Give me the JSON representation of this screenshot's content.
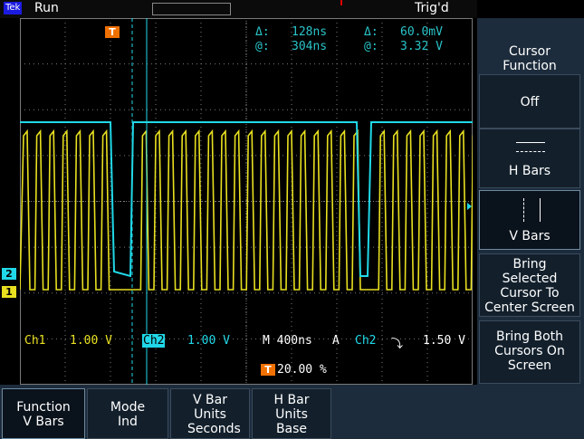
{
  "status": {
    "brand": "Tek",
    "run": "Run",
    "trigger": "Trig'd"
  },
  "cursor_readout": {
    "delta_time_label": "Δ:",
    "delta_time": "128ns",
    "delta_volt_label": "Δ:",
    "delta_volt": "60.0mV",
    "at_time_label": "@:",
    "at_time": "304ns",
    "at_volt_label": "@:",
    "at_volt": "3.32 V"
  },
  "channel_info": {
    "ch1_label": "Ch1",
    "ch1_scale": "1.00 V",
    "ch2_label": "Ch2",
    "ch2_scale": "1.00 V",
    "timebase": "M 400ns",
    "trig_mode": "A",
    "trig_source": "Ch2",
    "trig_level": "1.50 V",
    "trig_position": "20.00 %"
  },
  "markers": {
    "ch1": "1",
    "ch2": "2",
    "trigger": "T"
  },
  "side_menu": {
    "title": "Cursor Function",
    "off": "Off",
    "hbars": "H Bars",
    "vbars": "V Bars",
    "bring_selected": "Bring Selected Cursor To Center Screen",
    "bring_both": "Bring Both Cursors On Screen"
  },
  "bottom_menu": [
    {
      "top": "Function",
      "bottom": "V Bars"
    },
    {
      "top": "Mode",
      "bottom": "Ind"
    },
    {
      "top": "V Bar Units",
      "bottom": "Seconds"
    },
    {
      "top": "H Bar Units",
      "bottom": "Base"
    }
  ],
  "colors": {
    "ch1": "#e8e020",
    "ch2": "#20d8e8",
    "grid": "#7a7a7a",
    "trigger_marker": "#f07000"
  }
}
